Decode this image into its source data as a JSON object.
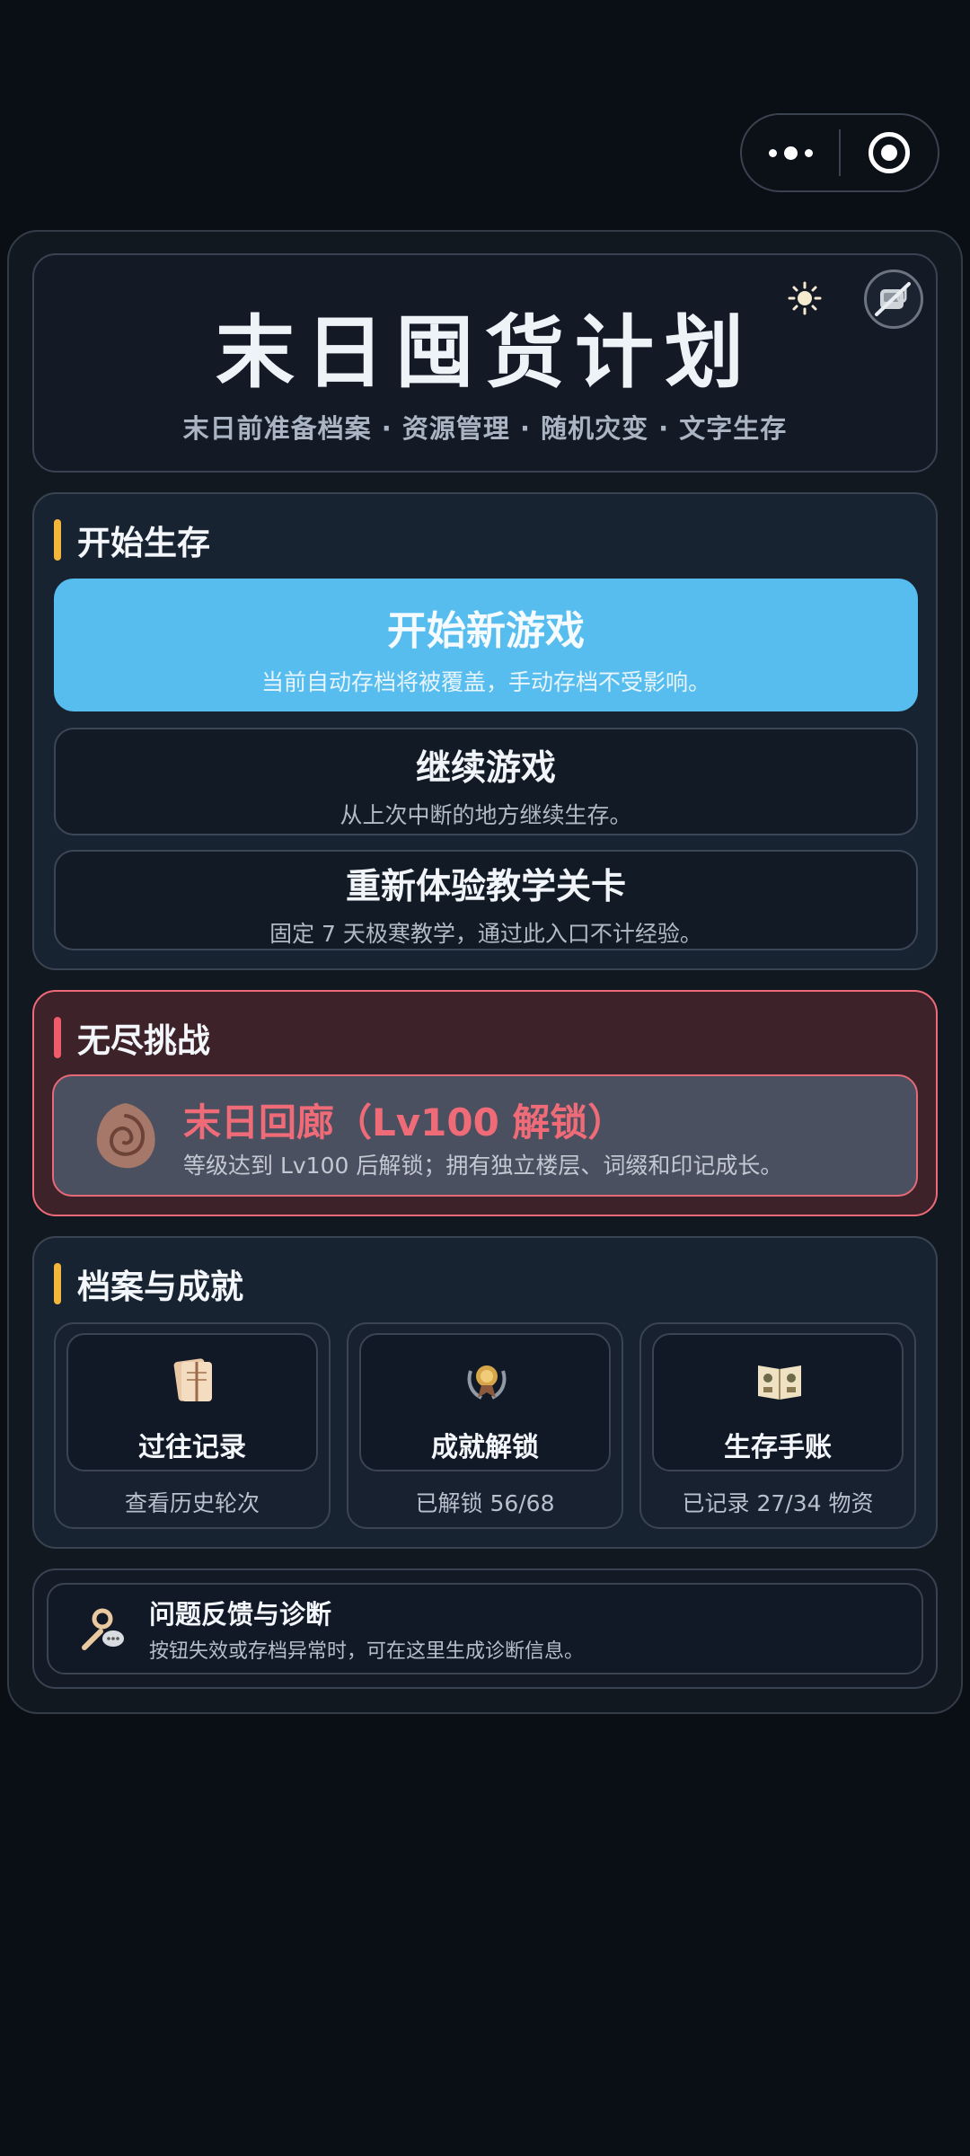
{
  "capsule": {
    "more_icon": "more-dots-icon",
    "close_icon": "target-circle-icon"
  },
  "header": {
    "title": "末日囤货计划",
    "subtitle": "末日前准备档案 · 资源管理 · 随机灾变 · 文字生存",
    "theme_icon": "sun-icon",
    "music_icon": "music-off-icon"
  },
  "start_section": {
    "label": "开始生存",
    "accent": "#f2b63c",
    "new_game": {
      "title": "开始新游戏",
      "desc": "当前自动存档将被覆盖，手动存档不受影响。"
    },
    "continue_game": {
      "title": "继续游戏",
      "desc": "从上次中断的地方继续生存。"
    },
    "tutorial": {
      "title": "重新体验教学关卡",
      "desc": "固定 7 天极寒教学，通过此入口不计经验。"
    }
  },
  "endless_section": {
    "label": "无尽挑战",
    "accent": "#ef5b6b",
    "corridor": {
      "icon": "spiral-shell-icon",
      "title": "末日回廊（Lv100 解锁）",
      "desc": "等级达到 Lv100 后解锁；拥有独立楼层、词缀和印记成长。"
    }
  },
  "archive_section": {
    "label": "档案与成就",
    "accent": "#f2b63c",
    "tiles": [
      {
        "icon": "scroll-papers-icon",
        "title": "过往记录",
        "sub": "查看历史轮次"
      },
      {
        "icon": "medal-laurel-icon",
        "title": "成就解锁",
        "sub": "已解锁 56/68"
      },
      {
        "icon": "open-book-icon",
        "title": "生存手账",
        "sub": "已记录 27/34 物资"
      }
    ]
  },
  "feedback": {
    "icon": "wrench-chat-icon",
    "title": "问题反馈与诊断",
    "desc": "按钮失效或存档异常时，可在这里生成诊断信息。"
  }
}
